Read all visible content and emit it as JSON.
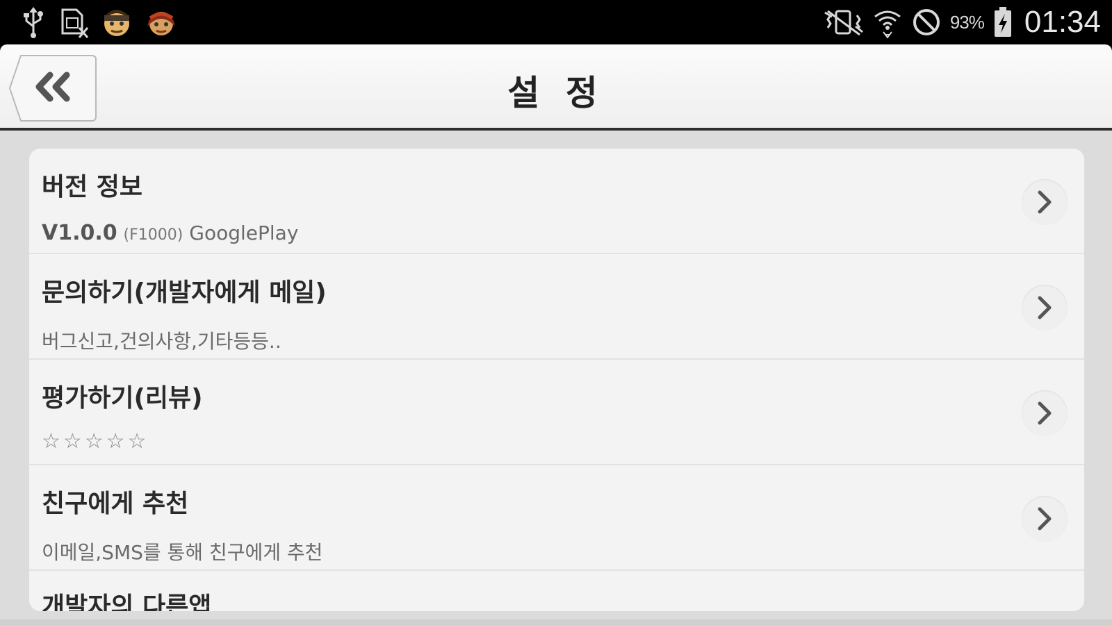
{
  "status_bar": {
    "icons_left": [
      "usb-icon",
      "sim-card-x-icon",
      "avatar-man-icon",
      "avatar-woman-icon"
    ],
    "icons_right": [
      "vibrate-mute-icon",
      "wifi-icon",
      "blocked-icon",
      "battery-charging-icon"
    ],
    "battery_percent": "93%",
    "clock": "01:34"
  },
  "header": {
    "title": "설 정",
    "back_icon": "double-chevron-left-icon"
  },
  "settings": [
    {
      "title": "버전 정보",
      "version_main": "V1.0.0",
      "version_code": "(F1000)",
      "version_store": "GooglePlay"
    },
    {
      "title": "문의하기(개발자에게 메일)",
      "subtitle": "버그신고,건의사항,기타등등.."
    },
    {
      "title": "평가하기(리뷰)",
      "subtitle": "☆☆☆☆☆"
    },
    {
      "title": "친구에게 추천",
      "subtitle": "이메일,SMS를 통해 친구에게 추천"
    },
    {
      "title": "개발자의 다른앱"
    }
  ],
  "colors": {
    "app_bar_bg": "#f4f4f4",
    "content_bg": "#dcdcdc",
    "list_bg": "#f3f3f3",
    "title_text": "#2a2a2a",
    "sub_text": "#6a6a6a"
  }
}
